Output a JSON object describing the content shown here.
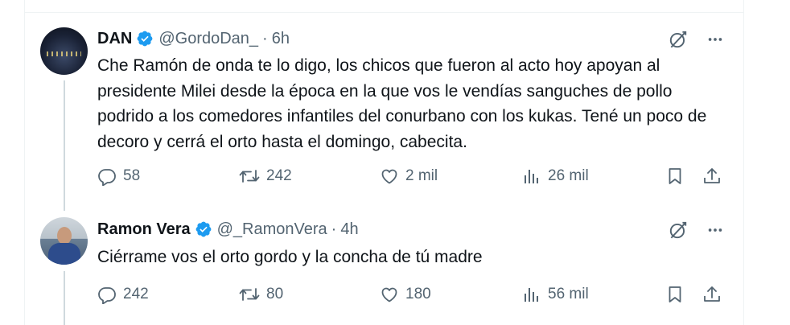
{
  "tweets": [
    {
      "name": "DAN",
      "handle": "@GordoDan_",
      "separator": "·",
      "time": "6h",
      "text": "Che Ramón de onda te lo digo, los chicos que fueron al acto hoy apoyan al presidente Milei desde la época en la que vos le vendías sanguches de pollo podrido a los comedores infantiles del conurbano con los kukas. Tené un poco de decoro y cerrá el orto hasta el domingo, cabecita.",
      "replies": "58",
      "retweets": "242",
      "likes": "2 mil",
      "views": "26 mil"
    },
    {
      "name": "Ramon Vera",
      "handle": "@_RamonVera",
      "separator": "·",
      "time": "4h",
      "text": "Ciérrame vos el orto gordo y la concha de tú madre",
      "replies": "242",
      "retweets": "80",
      "likes": "180",
      "views": "56 mil"
    }
  ],
  "icons": {
    "verified": "verified-badge-icon",
    "grok": "grok-icon",
    "more": "more-icon",
    "reply": "reply-icon",
    "retweet": "retweet-icon",
    "like": "like-icon",
    "views": "views-icon",
    "bookmark": "bookmark-icon",
    "share": "share-icon"
  },
  "colors": {
    "verified": "#1d9bf0",
    "text": "#0f1419",
    "secondary": "#536471",
    "thread_line": "#cfd9de",
    "border": "#eff3f4"
  }
}
